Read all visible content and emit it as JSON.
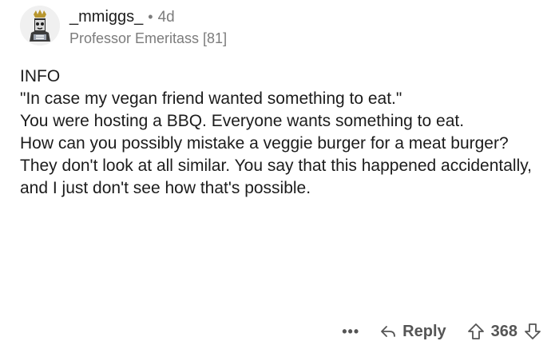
{
  "comment": {
    "author": "_mmiggs_",
    "separator": "•",
    "age": "4d",
    "flair": "Professor Emeritass [81]",
    "paragraphs": [
      "INFO",
      "\"In case my vegan friend wanted something to eat.\"",
      "You were hosting a BBQ. Everyone wants something to eat.",
      "How can you possibly mistake a veggie burger for a meat burger? They don't look at all similar. You say that this happened accidentally, and I just don't see how that's possible."
    ],
    "actions": {
      "more": "•••",
      "reply_label": "Reply",
      "score": "368"
    }
  },
  "icons": {
    "avatar": "avatar-icon",
    "reply": "reply-arrow-icon",
    "upvote": "upvote-arrow-icon",
    "downvote": "downvote-arrow-icon"
  },
  "colors": {
    "text": "#1c1c1c",
    "meta": "#7c7c7c",
    "actions": "#555555",
    "background": "#ffffff"
  }
}
